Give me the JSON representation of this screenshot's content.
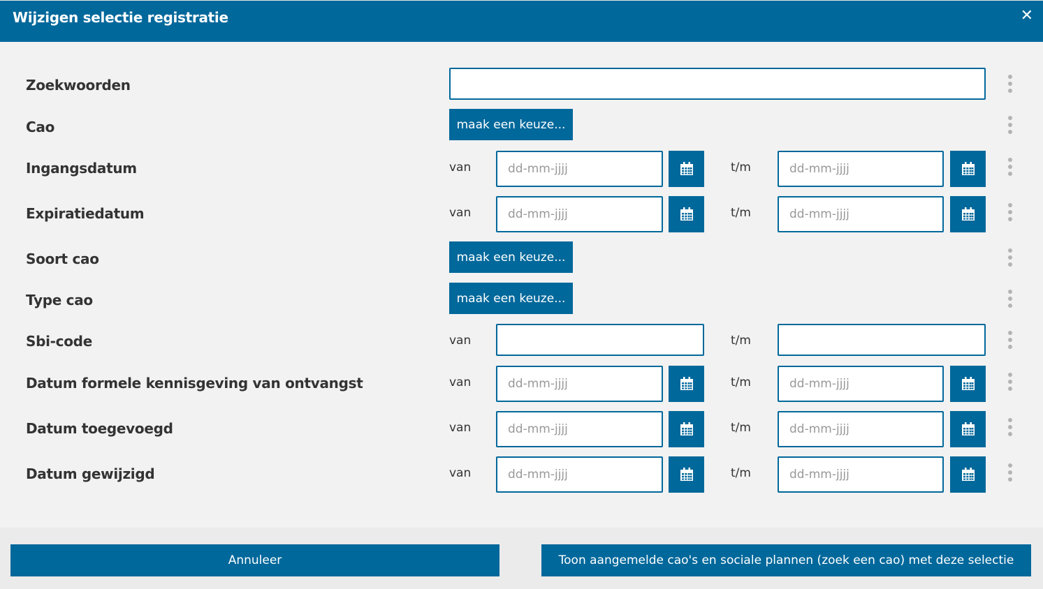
{
  "dialog": {
    "title": "Wijzigen selectie registratie",
    "close_symbol": "✕"
  },
  "labels": {
    "van": "van",
    "tm": "t/m",
    "date_placeholder": "dd-mm-jjjj",
    "choose": "maak een keuze..."
  },
  "fields": {
    "zoekwoorden": "Zoekwoorden",
    "cao": "Cao",
    "ingangsdatum": "Ingangsdatum",
    "expiratiedatum": "Expiratiedatum",
    "soort_cao": "Soort cao",
    "type_cao": "Type cao",
    "sbi_code": "Sbi-code",
    "datum_kennisgeving": "Datum formele kennisgeving van ontvangst",
    "datum_toegevoegd": "Datum toegevoegd",
    "datum_gewijzigd": "Datum gewijzigd"
  },
  "footer": {
    "cancel_label": "Annuleer",
    "submit_label": "Toon aangemelde cao's en sociale plannen (zoek een cao) met deze selectie"
  },
  "colors": {
    "primary": "#01689b",
    "background": "#f2f2f2",
    "footer_background": "#ebebeb",
    "kebab": "#b4b4b4"
  },
  "icons": {
    "calendar": "calendar-icon",
    "options": "kebab-menu-icon",
    "close": "close-icon"
  }
}
